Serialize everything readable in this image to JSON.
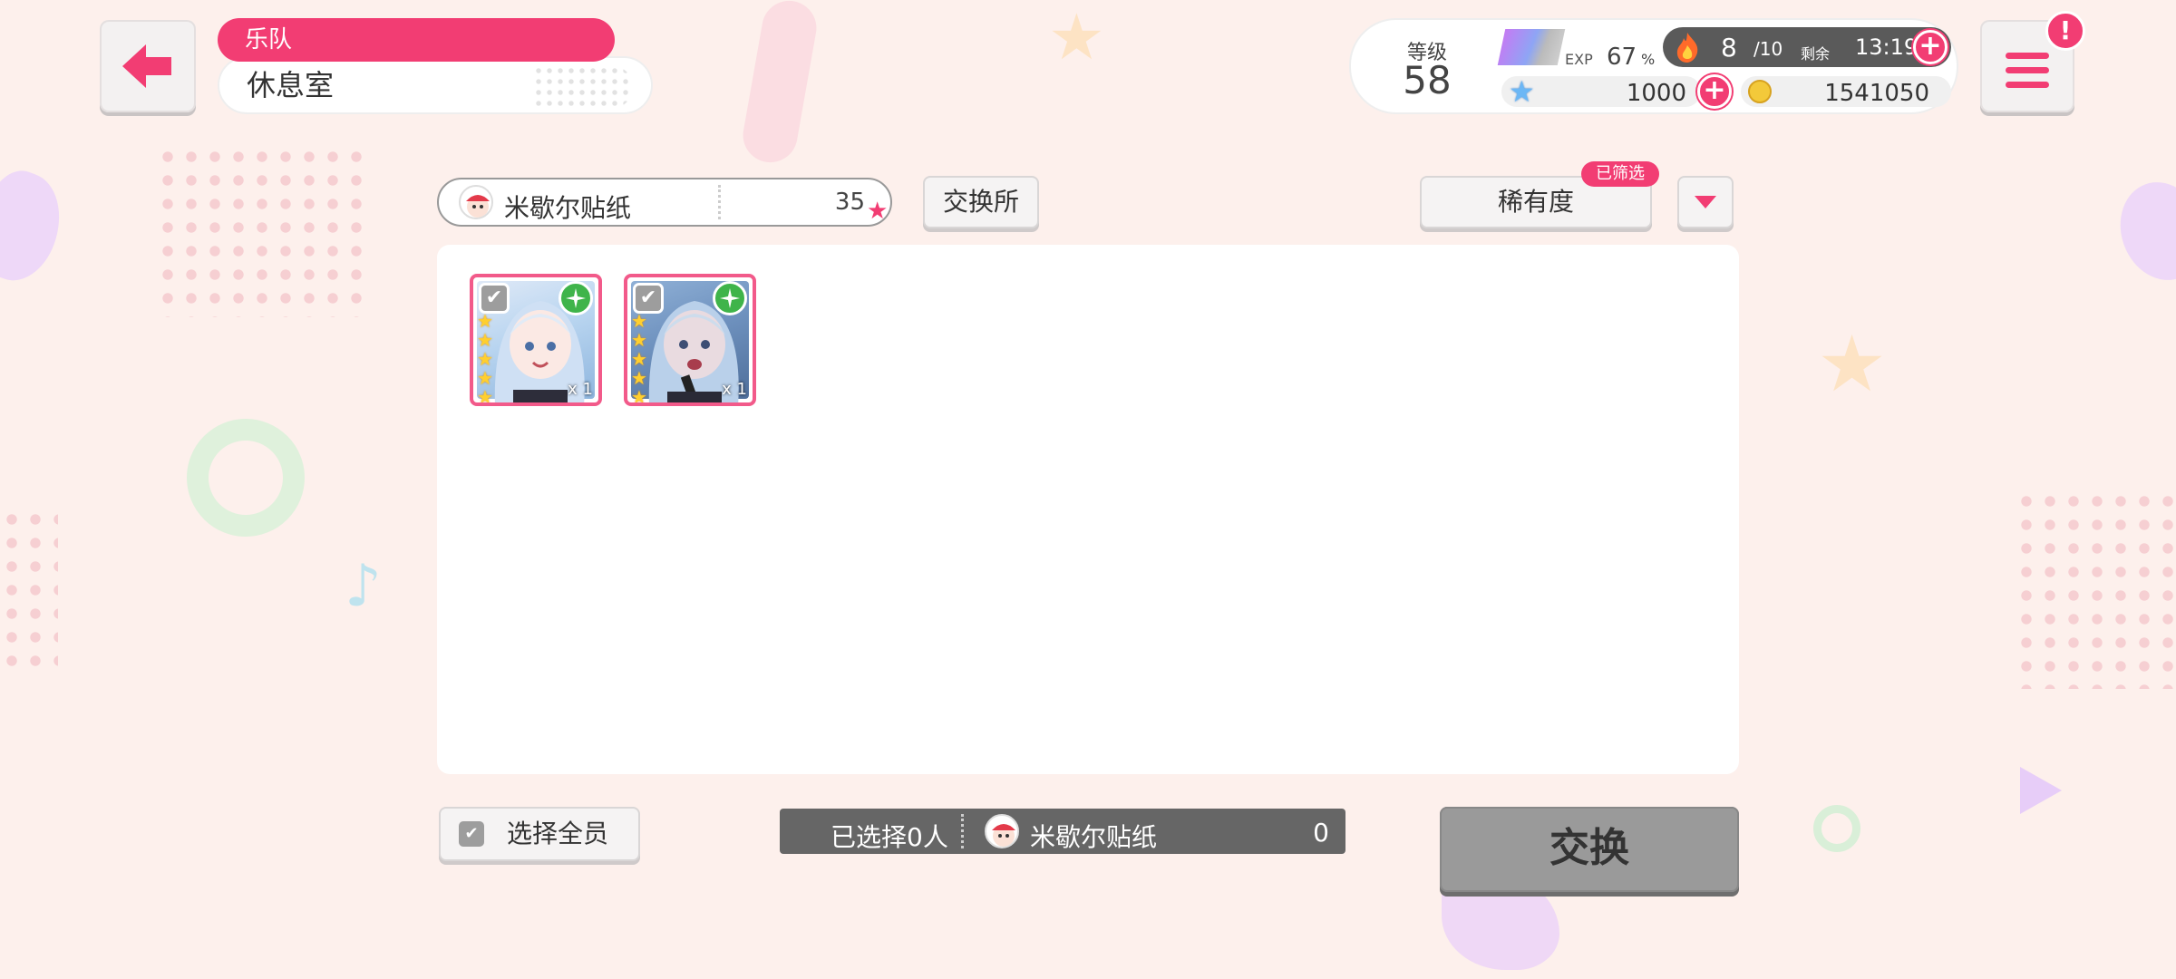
{
  "header": {
    "band_label": "乐队",
    "page_title": "休息室"
  },
  "status": {
    "level_label": "等级",
    "level": "58",
    "exp_label": "EXP",
    "exp_value": "67",
    "exp_unit": "%",
    "exp_progress": 0.67,
    "stamina": "8",
    "stamina_max": "/10",
    "remain_label": "剩余",
    "remain_time": "13:19",
    "star_gems": "1000",
    "coins": "1541050"
  },
  "menu": {
    "alert": "!"
  },
  "filter": {
    "item_name": "米歇尔贴纸",
    "item_count": "35",
    "exchange_shop_label": "交换所",
    "sort_label": "稀有度",
    "filtered_badge": "已筛选"
  },
  "cards": [
    {
      "rarity": 5,
      "quantity": "x 1",
      "attribute": "pure",
      "theme": "#9fc6e8"
    },
    {
      "rarity": 5,
      "quantity": "x 1",
      "attribute": "pure",
      "theme": "#7aa9d6"
    }
  ],
  "bottom": {
    "select_all_label": "选择全员",
    "selected_text": "已选择0人",
    "item_name": "米歇尔贴纸",
    "item_total": "0",
    "exchange_label": "交换"
  },
  "colors": {
    "accent": "#f23d73",
    "background": "#fdf0ec",
    "attribute_pure": "#3fb44a"
  }
}
